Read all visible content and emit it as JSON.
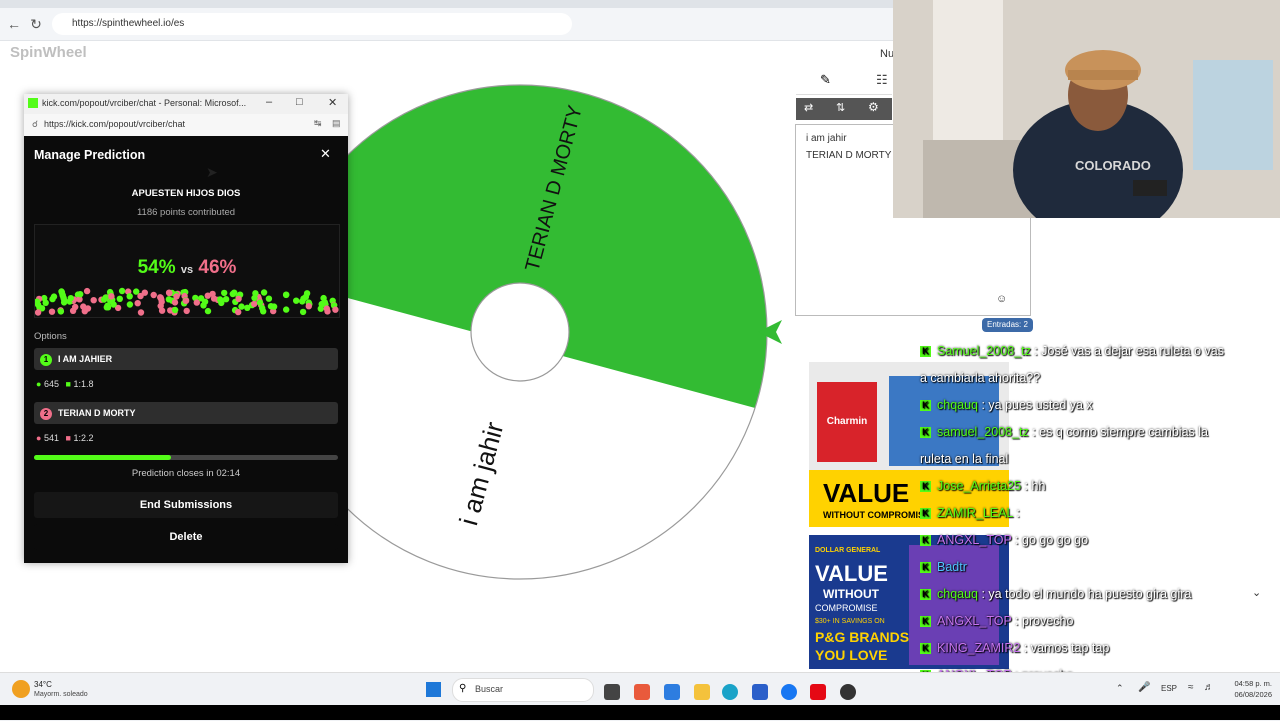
{
  "browser": {
    "url": "https://spinthewheel.io/es",
    "back_icon": "arrow-left-icon",
    "reload_icon": "reload-icon"
  },
  "site": {
    "logo_text": "SpinWheel",
    "nu_label": "Nu"
  },
  "wheel": {
    "slices": [
      {
        "label": "TERIAN D MORTY",
        "color": "#33bb33"
      },
      {
        "label": "i am jahir",
        "color": "#ffffff"
      }
    ]
  },
  "entries": {
    "lines": [
      "i am jahir",
      "TERIAN D MORTY"
    ],
    "count_badge": "Entradas: 2"
  },
  "popup": {
    "window_title": "kick.com/popout/vrciber/chat - Personal: Microsof...",
    "url": "https://kick.com/popout/vrciber/chat",
    "heading": "Manage Prediction",
    "question": "APUESTEN HIJOS DIOS",
    "points": "1186 points contributed",
    "pct_left": "54%",
    "vs": "vs",
    "pct_right": "46%",
    "options_label": "Options",
    "options": [
      {
        "num": "1",
        "name": "I AM JAHIER",
        "votes": "645",
        "ratio": "1:1.8",
        "color": "#53fc18"
      },
      {
        "num": "2",
        "name": "TERIAN D MORTY",
        "votes": "541",
        "ratio": "1:2.2",
        "color": "#f06f8a"
      }
    ],
    "progress_fraction": 0.45,
    "closes": "Prediction closes in 02:14",
    "end_btn": "End Submissions",
    "delete_btn": "Delete"
  },
  "chat": [
    {
      "user": "Samuel_2008_tz",
      "msg": ": José vas a dejar esa ruleta o vas",
      "color": "#53fc18"
    },
    {
      "user": "",
      "msg": "a cambiarla ahorita??",
      "color": "#53fc18"
    },
    {
      "user": "chqauq",
      "msg": ": ya pues usted ya x",
      "color": "#53fc18"
    },
    {
      "user": "samuel_2008_tz",
      "msg": ": es q como siempre cambias la",
      "color": "#53fc18"
    },
    {
      "user": "",
      "msg": "ruleta en la final",
      "color": "#53fc18"
    },
    {
      "user": "Jose_Arrieta25",
      "msg": ": hh",
      "color": "#53fc18"
    },
    {
      "user": "ZAMIR_LEAL",
      "msg": ":",
      "color": "#53fc18"
    },
    {
      "user": "ANGXL_TOP",
      "msg": ": go go go go",
      "color": "#c774f0"
    },
    {
      "user": "Badtr",
      "msg": "",
      "color": "#4fc3ff"
    },
    {
      "user": "chqauq",
      "msg": ": ya todo el mundo ha puesto gira gira",
      "color": "#53fc18"
    },
    {
      "user": "ANGXL_TOP",
      "msg": ": provecho",
      "color": "#c774f0"
    },
    {
      "user": "KING_ZAMIR2",
      "msg": ": vamos tap tap",
      "color": "#c774f0"
    },
    {
      "user": "ANGXL_TOP",
      "msg": ": provecho",
      "color": "#c774f0"
    }
  ],
  "ads": {
    "ad1_brand": "Charmin",
    "ad1_value": "VALUE",
    "ad1_sub": "WITHOUT COMPROMISE",
    "ad2_store": "DOLLAR GENERAL",
    "ad2_value": "VALUE",
    "ad2_without": "WITHOUT",
    "ad2_comp": "COMPROMISE",
    "ad2_savings": "$30+ IN SAVINGS ON",
    "ad2_brands": "P&G BRANDS",
    "ad2_love": "YOU LOVE"
  },
  "taskbar": {
    "weather_temp": "34°C",
    "weather_desc": "Mayorm. soleado",
    "search": "Buscar",
    "lang": "ESP",
    "time": "04:58 p. m.",
    "date": "06/08/2026"
  }
}
